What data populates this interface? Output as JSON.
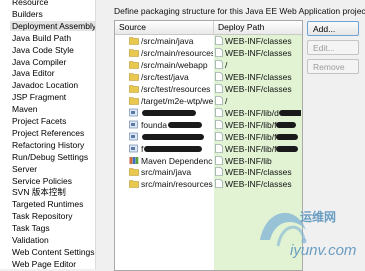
{
  "sidebar": {
    "items": [
      "Resource",
      "Builders",
      "Deployment Assembly",
      "Java Build Path",
      "Java Code Style",
      "Java Compiler",
      "Java Editor",
      "Javadoc Location",
      "JSP Fragment",
      "Maven",
      "Project Facets",
      "Project References",
      "Refactoring History",
      "Run/Debug Settings",
      "Server",
      "Service Policies",
      "SVN 版本控制",
      "Targeted Runtimes",
      "Task Repository",
      "Task Tags",
      "Validation",
      "Web Content Settings",
      "Web Page Editor"
    ],
    "selected_index": 2
  },
  "main": {
    "description": "Define packaging structure for this Java EE Web Application project.",
    "columns": [
      "Source",
      "Deploy Path"
    ],
    "rows": [
      {
        "icon": "folder-icon",
        "source": "/src/main/java",
        "deploy": "WEB-INF/classes",
        "redacted": false
      },
      {
        "icon": "folder-icon",
        "source": "/src/main/resources",
        "deploy": "WEB-INF/classes",
        "redacted": false
      },
      {
        "icon": "folder-icon",
        "source": "/src/main/webapp",
        "deploy": "/",
        "redacted": false
      },
      {
        "icon": "folder-icon",
        "source": "/src/test/java",
        "deploy": "WEB-INF/classes",
        "redacted": false
      },
      {
        "icon": "folder-icon",
        "source": "/src/test/resources",
        "deploy": "WEB-INF/classes",
        "redacted": false
      },
      {
        "icon": "folder-icon",
        "source": "/target/m2e-wtp/wel",
        "deploy": "/",
        "redacted": false
      },
      {
        "icon": "project-icon",
        "source": "",
        "deploy": "WEB-INF/lib/d",
        "redacted": true
      },
      {
        "icon": "project-icon",
        "source": "founda",
        "deploy": "WEB-INF/lib/f",
        "redacted": true
      },
      {
        "icon": "project-icon",
        "source": "",
        "deploy": "WEB-INF/lib/f",
        "redacted": true
      },
      {
        "icon": "project-icon",
        "source": "f",
        "deploy": "WEB-INF/lib/f",
        "redacted": true
      },
      {
        "icon": "library-icon",
        "source": "Maven Dependencies",
        "deploy": "WEB-INF/lib",
        "redacted": false
      },
      {
        "icon": "folder-icon",
        "source": "src/main/java",
        "deploy": "WEB-INF/classes",
        "redacted": false
      },
      {
        "icon": "folder-icon",
        "source": "src/main/resources",
        "deploy": "WEB-INF/classes",
        "redacted": false
      }
    ]
  },
  "buttons": {
    "add": "Add...",
    "edit": "Edit...",
    "remove": "Remove"
  },
  "colors": {
    "deploy_column_bg": "#e2f3d4",
    "folder": "#e8c84e",
    "watermark": "#7fb2d6"
  },
  "watermark": {
    "cn_text": "运维网",
    "url_text": "iyunv.com"
  }
}
